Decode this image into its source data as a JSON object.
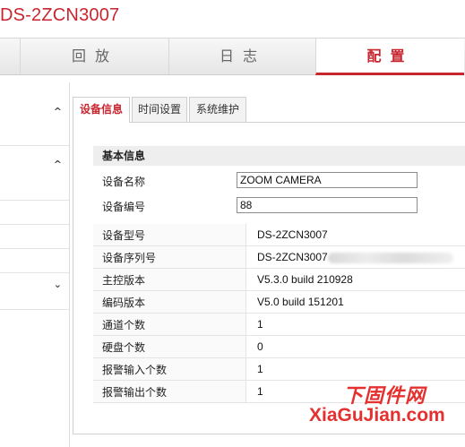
{
  "app": {
    "title": "DS-2ZCN3007"
  },
  "nav": {
    "tabs": [
      {
        "label": "回放"
      },
      {
        "label": "日志"
      },
      {
        "label": "配置"
      }
    ]
  },
  "sidebar": {
    "chevrons": {
      "up1": "^",
      "up2": "^",
      "down": "⌄"
    }
  },
  "content": {
    "tabs": [
      {
        "label": "设备信息"
      },
      {
        "label": "时间设置"
      },
      {
        "label": "系统维护"
      }
    ],
    "section_title": "基本信息",
    "fields": [
      {
        "label": "设备名称",
        "value": "ZOOM CAMERA"
      },
      {
        "label": "设备编号",
        "value": "88"
      }
    ],
    "info": [
      {
        "label": "设备型号",
        "value": "DS-2ZCN3007"
      },
      {
        "label": "设备序列号",
        "value": "DS-2ZCN3007"
      },
      {
        "label": "主控版本",
        "value": "V5.3.0 build 210928"
      },
      {
        "label": "编码版本",
        "value": "V5.0 build 151201"
      },
      {
        "label": "通道个数",
        "value": "1"
      },
      {
        "label": "硬盘个数",
        "value": "0"
      },
      {
        "label": "报警输入个数",
        "value": "1"
      },
      {
        "label": "报警输出个数",
        "value": "1"
      }
    ]
  },
  "watermark": {
    "cn": "下固件网",
    "en": "XiaGuJian.com"
  },
  "colors": {
    "accent": "#c8262f",
    "watermark": "#e53030"
  }
}
